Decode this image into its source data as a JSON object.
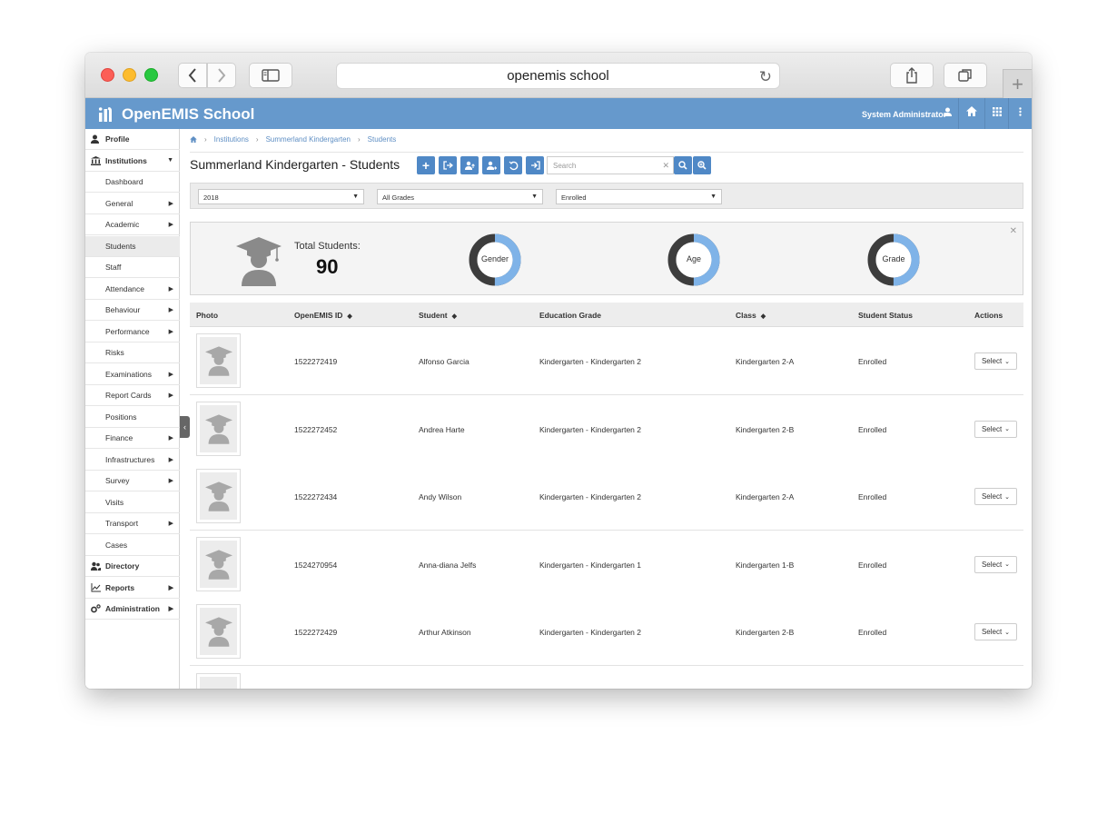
{
  "browser": {
    "url": "openemis school",
    "colors": {
      "close": "#fc5f57",
      "minimize": "#fdbc2e",
      "maximize": "#28c840"
    }
  },
  "header": {
    "app_name": "OpenEMIS School",
    "user": "System Administrator",
    "brand_color": "#6699cc"
  },
  "sidebar": {
    "items": [
      {
        "label": "Profile",
        "level": "top",
        "icon": "user-icon"
      },
      {
        "label": "Institutions",
        "level": "top",
        "icon": "institution-icon",
        "expanded": true
      },
      {
        "label": "Dashboard",
        "level": "sub"
      },
      {
        "label": "General",
        "level": "sub",
        "submenu": true
      },
      {
        "label": "Academic",
        "level": "sub",
        "submenu": true
      },
      {
        "label": "Students",
        "level": "sub",
        "active": true
      },
      {
        "label": "Staff",
        "level": "sub"
      },
      {
        "label": "Attendance",
        "level": "sub",
        "submenu": true
      },
      {
        "label": "Behaviour",
        "level": "sub",
        "submenu": true
      },
      {
        "label": "Performance",
        "level": "sub",
        "submenu": true
      },
      {
        "label": "Risks",
        "level": "sub"
      },
      {
        "label": "Examinations",
        "level": "sub",
        "submenu": true
      },
      {
        "label": "Report Cards",
        "level": "sub",
        "submenu": true
      },
      {
        "label": "Positions",
        "level": "sub"
      },
      {
        "label": "Finance",
        "level": "sub",
        "submenu": true
      },
      {
        "label": "Infrastructures",
        "level": "sub",
        "submenu": true
      },
      {
        "label": "Survey",
        "level": "sub",
        "submenu": true
      },
      {
        "label": "Visits",
        "level": "sub"
      },
      {
        "label": "Transport",
        "level": "sub",
        "submenu": true
      },
      {
        "label": "Cases",
        "level": "sub"
      },
      {
        "label": "Directory",
        "level": "top",
        "icon": "users-icon"
      },
      {
        "label": "Reports",
        "level": "top",
        "icon": "chart-icon",
        "submenu": true
      },
      {
        "label": "Administration",
        "level": "top",
        "icon": "cogs-icon",
        "submenu": true
      }
    ]
  },
  "breadcrumb": [
    "Institutions",
    "Summerland Kindergarten",
    "Students"
  ],
  "page": {
    "title": "Summerland Kindergarten - Students"
  },
  "toolbar": {
    "buttons": [
      "add-icon",
      "import-icon",
      "promote-icon",
      "transfer-icon",
      "undo-icon",
      "export-icon"
    ],
    "search_placeholder": "Search"
  },
  "filters": {
    "year": "2018",
    "grade": "All Grades",
    "status": "Enrolled"
  },
  "dashboard": {
    "total_label": "Total Students:",
    "total_value": "90",
    "charts": [
      "Gender",
      "Age",
      "Grade"
    ],
    "chart_colors": {
      "dark": "#3d3d3d",
      "light": "#7fb3e8"
    }
  },
  "table": {
    "headers": {
      "photo": "Photo",
      "id": "OpenEMIS ID",
      "student": "Student",
      "grade": "Education Grade",
      "class": "Class",
      "status": "Student Status",
      "actions": "Actions"
    },
    "action_label": "Select",
    "rows": [
      {
        "id": "1522272419",
        "student": "Alfonso Garcia",
        "grade": "Kindergarten - Kindergarten 2",
        "class": "Kindergarten 2-A",
        "status": "Enrolled"
      },
      {
        "id": "1522272452",
        "student": "Andrea Harte",
        "grade": "Kindergarten - Kindergarten 2",
        "class": "Kindergarten 2-B",
        "status": "Enrolled"
      },
      {
        "id": "1522272434",
        "student": "Andy Wilson",
        "grade": "Kindergarten - Kindergarten 2",
        "class": "Kindergarten 2-A",
        "status": "Enrolled"
      },
      {
        "id": "1524270954",
        "student": "Anna-diana Jelfs",
        "grade": "Kindergarten - Kindergarten 1",
        "class": "Kindergarten 1-B",
        "status": "Enrolled"
      },
      {
        "id": "1522272429",
        "student": "Arthur Atkinson",
        "grade": "Kindergarten - Kindergarten 2",
        "class": "Kindergarten 2-B",
        "status": "Enrolled"
      }
    ]
  }
}
